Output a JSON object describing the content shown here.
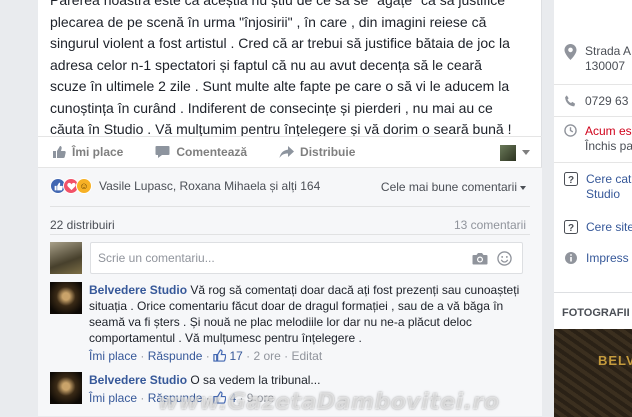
{
  "post": {
    "lines": [
      "Părerea noastră este că aceștia nu știu de ce să se \"agațe\" ca să justifice",
      "plecarea de pe scenă în urma \"înjosirii\" , în care , din imagini reiese că",
      "singurul violent a fost artistul . Cred că ar trebui să justifice bătaia de joc la",
      "adresa celor n-1 spectatori și faptul că nu au avut decența să le ceară",
      "scuze în ultimele 2 zile . Sunt multe alte fapte pe care o să vi le aducem la",
      "cunoștința în curând . Indiferent de consecințe și pierderi , nu mai au ce",
      "căuta în Studio . Vă mulțumim pentru înțelegere și vă dorim o seară bună !"
    ],
    "actions": {
      "like": "Îmi place",
      "comment": "Comentează",
      "share": "Distribuie"
    }
  },
  "reactions": {
    "names": "Vasile Lupasc, Roxana Mihaela și alți 164",
    "top_comments": "Cele mai bune comentarii",
    "shares": "22 distribuiri",
    "comments": "13 comentarii"
  },
  "composer": {
    "placeholder": "Scrie un comentariu..."
  },
  "comments": [
    {
      "author": "Belvedere Studio",
      "text": "Vă rog să comentați doar dacă ați fost prezenți sau cunoașteți situația . Orice comentariu făcut doar de dragul formației , sau de a vă băga în seamă va fi șters . Și nouă ne plac melodiile lor dar nu ne-a plăcut deloc comportamentul . Vă mulțumesc pentru înțelegere .",
      "like": "Îmi place",
      "reply": "Răspunde",
      "likes": "17",
      "time": "2 ore",
      "edited": "Editat"
    },
    {
      "author": "Belvedere Studio",
      "text": "O sa vedem la tribunal...",
      "like": "Îmi place",
      "reply": "Răspunde",
      "likes": "4",
      "time": "9 ore"
    }
  ],
  "sidebar": {
    "address_1": "Strada A",
    "address_2": "130007",
    "phone": "0729 63",
    "open_now": "Acum es",
    "closed": "Închis pa",
    "suggest_1": "Cere cat",
    "suggest_2": "Studio",
    "suggest_3": "Cere site",
    "impress": "Impress",
    "photos_title": "FOTOGRAFII",
    "photo_text": "BELVE"
  },
  "watermark": "www.GazetaDambovitei.ro",
  "colors": {
    "link": "#365899",
    "like_blue": "#4267b2",
    "love_red": "#f25268",
    "haha_yellow": "#f7b125",
    "open_red": "#d0021b"
  }
}
